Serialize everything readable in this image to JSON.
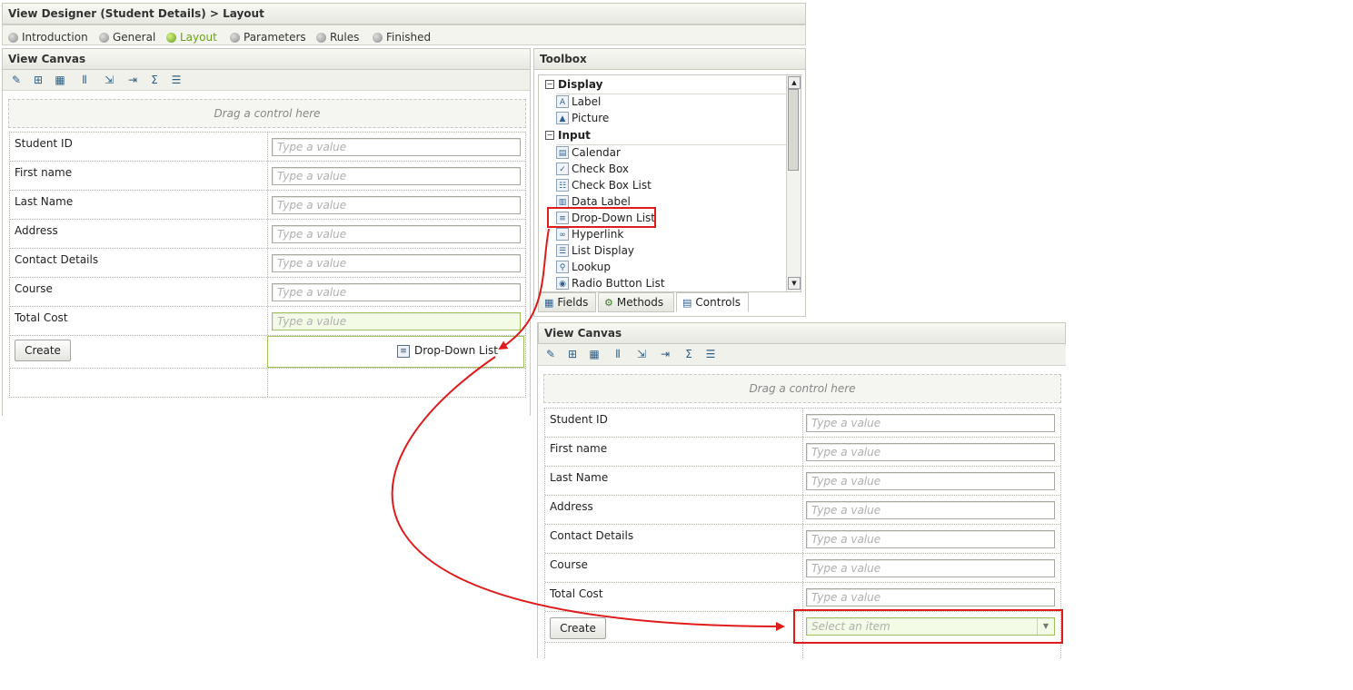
{
  "window": {
    "title": "View Designer (Student Details) > Layout"
  },
  "steps": [
    {
      "label": "Introduction",
      "active": false
    },
    {
      "label": "General",
      "active": false
    },
    {
      "label": "Layout",
      "active": true
    },
    {
      "label": "Parameters",
      "active": false
    },
    {
      "label": "Rules",
      "active": false
    },
    {
      "label": "Finished",
      "active": false
    }
  ],
  "canvas": {
    "title": "View Canvas",
    "drag_hint": "Drag a control here",
    "placeholder": "Type a value",
    "fields": [
      "Student ID",
      "First name",
      "Last Name",
      "Address",
      "Contact Details",
      "Course",
      "Total Cost"
    ],
    "create_label": "Create",
    "dropped_control": "Drop-Down List"
  },
  "toolbox": {
    "title": "Toolbox",
    "categories": [
      {
        "name": "Display",
        "items": [
          "Label",
          "Picture"
        ]
      },
      {
        "name": "Input",
        "items": [
          "Calendar",
          "Check Box",
          "Check Box List",
          "Data Label",
          "Drop-Down List",
          "Hyperlink",
          "List Display",
          "Lookup",
          "Radio Button List"
        ]
      }
    ],
    "tabs": [
      {
        "label": "Fields",
        "icon": "fields-icon",
        "active": false
      },
      {
        "label": "Methods",
        "icon": "methods-icon",
        "active": false
      },
      {
        "label": "Controls",
        "icon": "controls-icon",
        "active": true
      }
    ]
  },
  "result_canvas": {
    "title": "View Canvas",
    "drag_hint": "Drag a control here",
    "placeholder": "Type a value",
    "fields": [
      "Student ID",
      "First name",
      "Last Name",
      "Address",
      "Contact Details",
      "Course",
      "Total Cost"
    ],
    "create_label": "Create",
    "dropdown_placeholder": "Select an item"
  },
  "colors": {
    "annotation": "#e01b1b",
    "active_step": "#6aa01e",
    "selected_field": "#f3fae6"
  },
  "toolbar_icons": [
    "wand-icon",
    "add-table-icon",
    "edit-table-icon",
    "columns-icon",
    "insert-row-icon",
    "export-icon",
    "sum-icon",
    "properties-icon"
  ]
}
